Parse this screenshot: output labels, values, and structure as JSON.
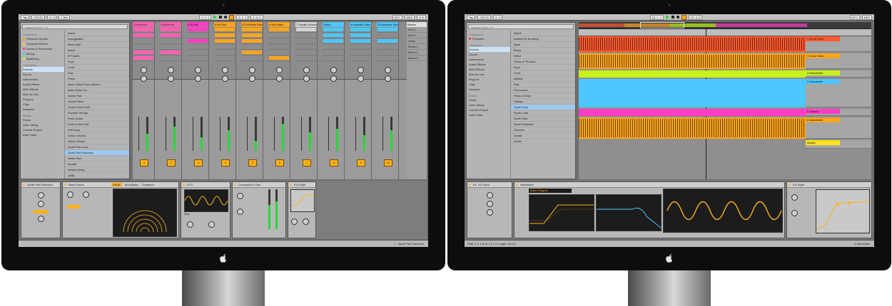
{
  "left": {
    "view": "Session",
    "browser": {
      "search_placeholder": "Search (Cmd + F)",
      "collections_title": "Collections",
      "collections": [
        {
          "label": "Favourite Synths",
          "color": "#ffa51e"
        },
        {
          "label": "Favourite Effects",
          "color": "#ffd11a"
        },
        {
          "label": "Drums & Percussion",
          "color": "#ff3d99"
        },
        {
          "label": "Mixing",
          "color": "#4cc7ff"
        },
        {
          "label": "Mastering",
          "color": "#b0ff3a"
        }
      ],
      "categories_title": "Categories",
      "categories": [
        "Sounds",
        "Drums",
        "Instruments",
        "Audio Effects",
        "MIDI Effects",
        "Max for Live",
        "Plug-ins",
        "Clips",
        "Samples"
      ],
      "places_title": "Places",
      "places": [
        "Packs",
        "User Library",
        "Current Project",
        "Add Folder..."
      ],
      "name_header": "Name",
      "items": [
        "Arpeggiated",
        "Bass Stab",
        "Brass",
        "EP Synth",
        "Keys",
        "Lead",
        "Pad",
        "Piano",
        "Bass Guitar From Ableton",
        "Bass Guitar Sy...",
        "Guitar Pad",
        "Grand Piano",
        "Grand Piano Soft",
        "Plucked Strings",
        "Punk Guitar",
        "Punk Guitar Soft",
        "Soft Keys",
        "Guitar Chords",
        "Guitar Vibrato",
        "Synth Pad Lead",
        "Synth Pad Palomino",
        "Warm Pad",
        "Bundle",
        "Simple Delay",
        "Utility"
      ],
      "selected_item": "Synth Pad Palomino"
    },
    "tracks": [
      {
        "name": "1 Drum Kit",
        "color": "#ff5fb2",
        "num": "1"
      },
      {
        "name": "2 Drum Kit",
        "color": "#ff5fb2",
        "num": "2"
      },
      {
        "name": "3 Hi Hat",
        "color": "#ff3dc4",
        "num": "3"
      },
      {
        "name": "4 Hit Sus",
        "color": "#ffa51e",
        "num": "4"
      },
      {
        "name": "5 Out Bass Piano",
        "color": "#ffa51e",
        "num": "5"
      },
      {
        "name": "6 Vox Bass",
        "color": "#ffa51e",
        "num": "6"
      },
      {
        "name": "7 Vocals Groove",
        "color": "#d4d4d4",
        "num": "7"
      },
      {
        "name": "Snare",
        "color": "#4cc7ff",
        "num": "8"
      },
      {
        "name": "9 Acoustic Slice",
        "color": "#4cc7ff",
        "num": "9"
      },
      {
        "name": "10 Acoustic Slice",
        "color": "#4cc7ff",
        "num": "10"
      }
    ],
    "master": {
      "label": "Master",
      "scenes": [
        "Intro 1",
        "Intro 2",
        "Verse",
        "Break 1",
        "Break 2",
        "Break 3"
      ]
    },
    "devices": [
      {
        "title": "Synth Pad Palomino"
      },
      {
        "title": "Basic Drone",
        "tabs": [
          "Drone",
          "Modulation",
          "Character"
        ]
      },
      {
        "title": "LFO",
        "display": "Sine"
      },
      {
        "title": "Compressor Glue"
      },
      {
        "title": "EQ Eight"
      }
    ],
    "status_right": "1 - Synth Pad Palomino"
  },
  "right": {
    "view": "Arrangement",
    "browser": {
      "collections_title": "Collections",
      "collections": [
        {
          "label": "Favorites",
          "color": "#ff4040"
        }
      ],
      "categories_title": "Categories",
      "categories": [
        "Sounds",
        "Drums",
        "Instruments",
        "Audio Effects",
        "MIDI Effects",
        "Max for Live",
        "Plug-ins",
        "Clips",
        "Samples"
      ],
      "places_title": "Places",
      "places": [
        "Packs",
        "User Library",
        "Current Project",
        "Add Folder..."
      ],
      "name_header": "Name",
      "items": [
        "Ambient & Evolving",
        "Bass",
        "Brass",
        "Effect",
        "Guitar & Plucked",
        "Keys",
        "Lead",
        "Mallets",
        "Pad",
        "Percussion",
        "Piano & Keys",
        "Strings",
        "Synth Keys",
        "Synth Lead",
        "Synth Misc",
        "Synth Rhythmic",
        "Textures",
        "Vocals",
        "Winds"
      ],
      "selected_item": "Synth Keys"
    },
    "tracks": [
      {
        "name": "1 Drum Rack",
        "color": "#ff5a2e"
      },
      {
        "name": "2 Drum Rack",
        "color": "#ffa51e"
      },
      {
        "name": "3 Wavetable",
        "color": "#c7f21c"
      },
      {
        "name": "4 Wavetable",
        "color": "#4cc7ff"
      },
      {
        "name": "5 Sample",
        "color": "#ff3dc4"
      },
      {
        "name": "6 Wavetable",
        "color": "#ffa51e"
      },
      {
        "name": "Master",
        "color": "#ffe21a"
      }
    ],
    "devices": [
      {
        "title": "Ex. Hi Chord"
      },
      {
        "title": "Wavetable",
        "osc": "Basic Shapes"
      },
      {
        "title": "EQ Eight"
      }
    ],
    "status_left": "Start: 1.1.1  End: 17.1.1  Length: 16.0.0",
    "status_right": "3 Wavetable"
  }
}
